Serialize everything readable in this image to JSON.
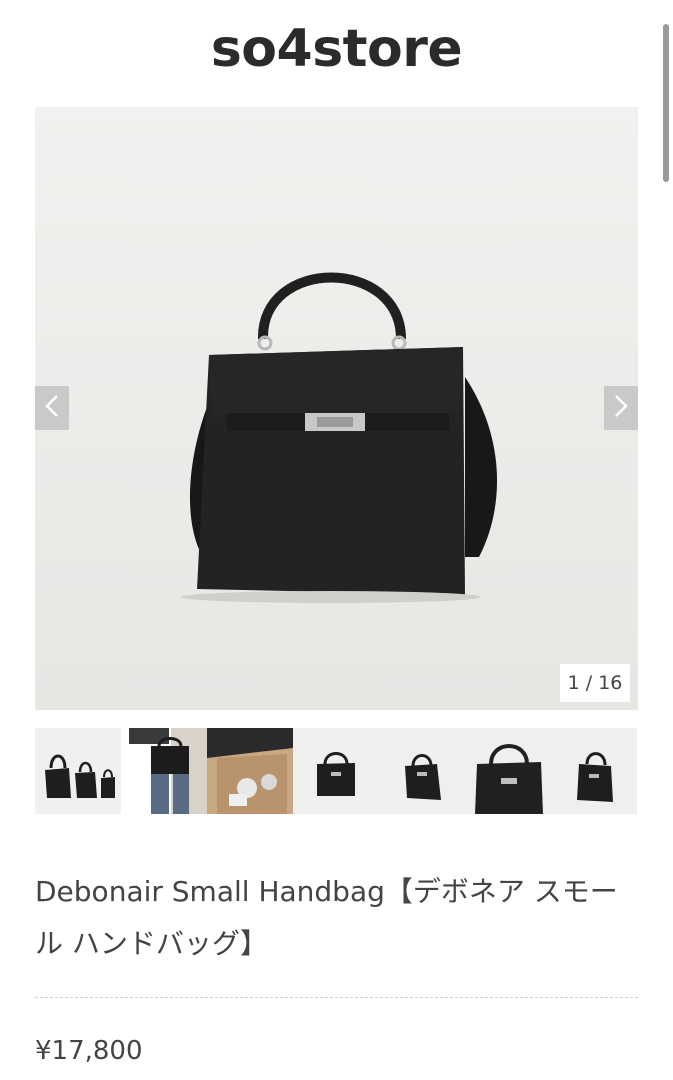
{
  "header": {
    "store_name": "so4store"
  },
  "gallery": {
    "counter": "1 / 16",
    "prev_icon": "chevron-left-icon",
    "next_icon": "chevron-right-icon",
    "thumbnail_count": 7
  },
  "product": {
    "title": "Debonair Small Handbag【デボネア スモール ハンドバッグ】",
    "price": "¥17,800"
  },
  "colors": {
    "background": "#ffffff",
    "photo_bg": "#ededeb",
    "bag": "#1f1f1f",
    "arrow_bg": "#c9c9c9"
  }
}
